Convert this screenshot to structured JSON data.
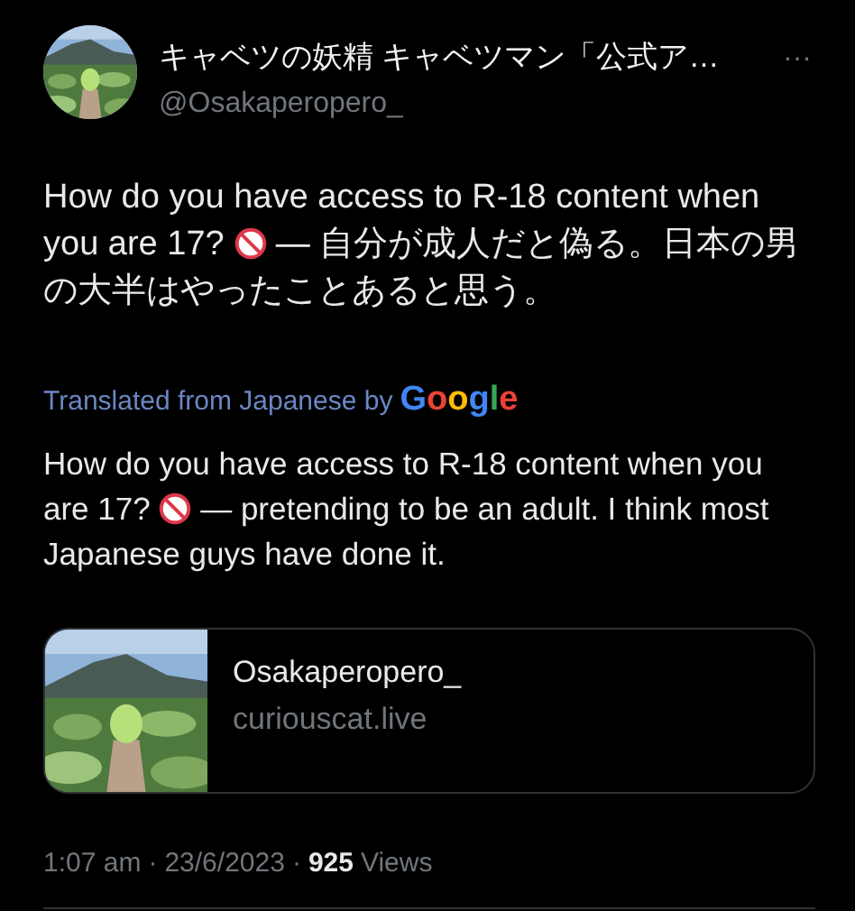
{
  "author": {
    "display_name": "キャベツの妖精 キャベツマン「公式ア…",
    "handle": "@Osakaperopero_"
  },
  "more_menu": "···",
  "tweet_text": {
    "before": "How do you have access to R-18 content when you are 17?",
    "after": "— 自分が成人だと偽る。日本の男の大半はやったことあると思う。"
  },
  "translation": {
    "label": "Translated from Japanese by",
    "brand": "Google",
    "before": "How do you have access to R-18 content when you are 17?",
    "after": "— pretending to be an adult. I think most Japanese guys have done it."
  },
  "link_card": {
    "title": "Osakaperopero_",
    "domain": "curiouscat.live"
  },
  "meta": {
    "time": "1:07 am",
    "separator_1": "·",
    "date": "23/6/2023",
    "separator_2": "·",
    "views_count": "925",
    "views_label": "Views"
  }
}
